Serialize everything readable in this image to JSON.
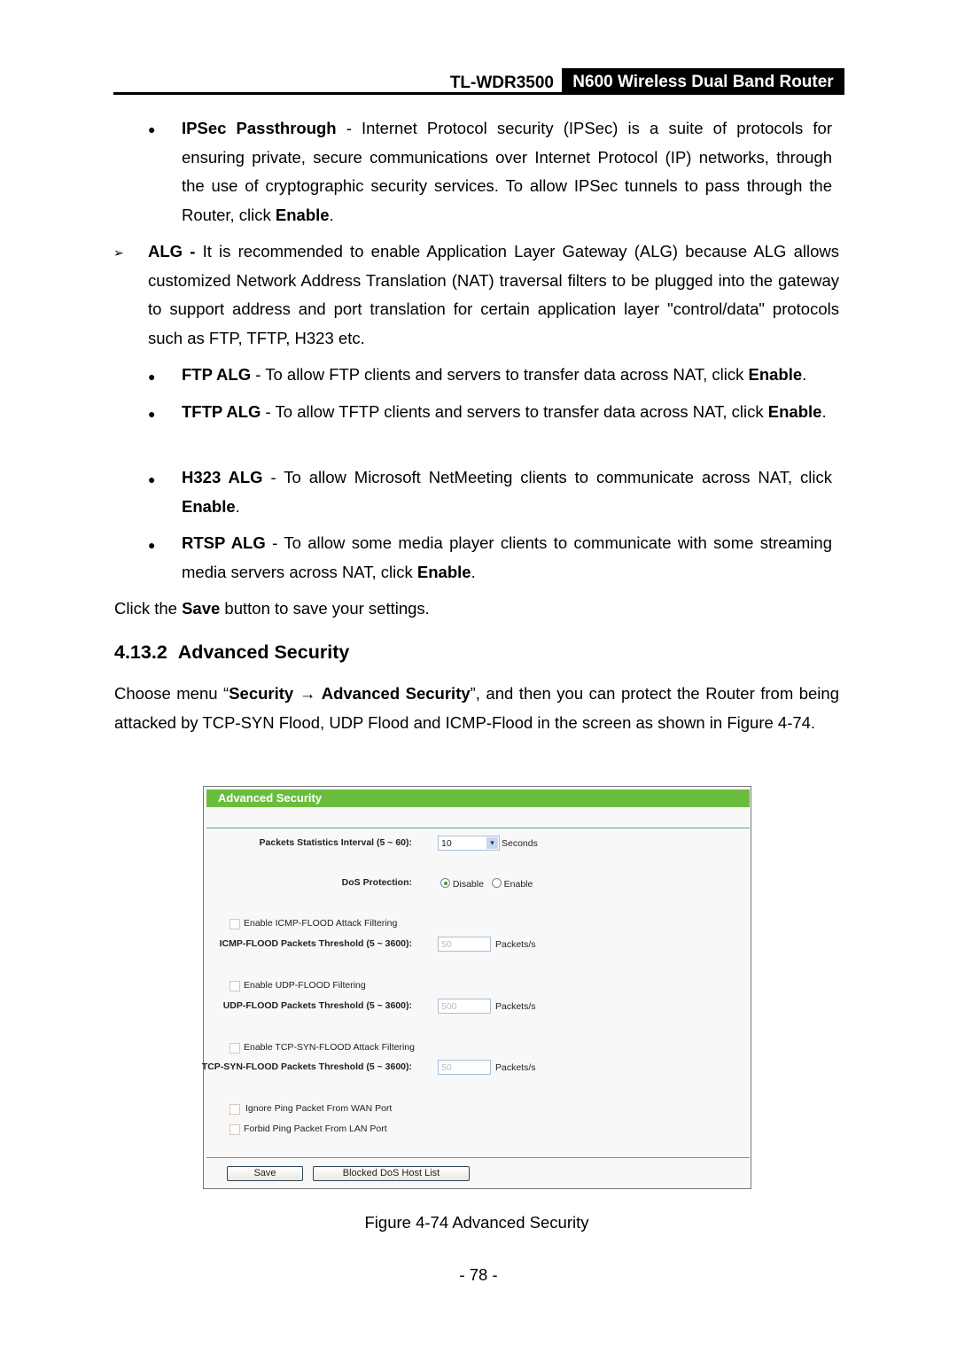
{
  "header": {
    "model": "TL-WDR3500",
    "product": "N600 Wireless Dual Band Router"
  },
  "ipsec": {
    "term": "IPSec Passthrough",
    "text": " - Internet Protocol security (IPSec) is a suite of protocols for ensuring private, secure communications over Internet Protocol (IP) networks, through the use of cryptographic security services. To allow IPSec tunnels to pass through the Router, click ",
    "action": "Enable",
    "end": "."
  },
  "alg": {
    "term": "ALG -",
    "text": " It is recommended to enable Application Layer Gateway (ALG) because ALG allows customized Network Address Translation (NAT) traversal filters to be plugged into the gateway to support address and port translation for certain application layer \"control/data\" protocols such as FTP, TFTP, H323 etc."
  },
  "alg_items": [
    {
      "term": "FTP ALG",
      "text": " - To allow FTP clients and servers to transfer data across NAT, click ",
      "action": "Enable",
      "end": "."
    },
    {
      "term": "TFTP ALG",
      "text": " - To allow TFTP clients and servers to transfer data across NAT, click ",
      "action": "Enable",
      "end": "."
    },
    {
      "term": "H323 ALG",
      "text": " - To allow Microsoft NetMeeting clients to communicate across NAT, click ",
      "action": "Enable",
      "end": "."
    },
    {
      "term": "RTSP ALG",
      "text": " - To allow some media player clients to communicate with some streaming media servers across NAT, click ",
      "action": "Enable",
      "end": "."
    }
  ],
  "save_note": {
    "pre": "Click the ",
    "bold": "Save",
    "post": " button to save your settings."
  },
  "section": {
    "number": "4.13.2",
    "title": "Advanced Security"
  },
  "intro": {
    "pre": "Choose menu “",
    "menu1": "Security",
    "arrow": "→",
    "menu2": "Advanced Security",
    "post": "”, and then you can protect the Router from being attacked by TCP-SYN Flood, UDP Flood and ICMP-Flood in the screen as shown in Figure 4-74."
  },
  "figure": {
    "title": "Advanced Security",
    "interval_label": "Packets Statistics Interval (5 ~ 60):",
    "interval_value": "10",
    "interval_unit": "Seconds",
    "dos_label": "DoS Protection:",
    "dos_options": [
      "Disable",
      "Enable"
    ],
    "dos_selected": "Disable",
    "icmp_check": "Enable ICMP-FLOOD Attack Filtering",
    "icmp_label": "ICMP-FLOOD Packets Threshold (5 ~ 3600):",
    "icmp_value": "50",
    "udp_check": "Enable UDP-FLOOD Filtering",
    "udp_label": "UDP-FLOOD Packets Threshold (5 ~ 3600):",
    "udp_value": "500",
    "tcp_check": "Enable TCP-SYN-FLOOD Attack Filtering",
    "tcp_label": "TCP-SYN-FLOOD Packets Threshold (5 ~ 3600):",
    "tcp_value": "50",
    "unit": "Packets/s",
    "wan_check": "Ignore Ping Packet From WAN Port",
    "lan_check": "Forbid Ping Packet From LAN Port",
    "save_button": "Save",
    "blocked_button": "Blocked DoS Host List",
    "accent": "#6abd3c"
  },
  "caption": "Figure 4-74 Advanced Security",
  "page_number": "- 78 -"
}
